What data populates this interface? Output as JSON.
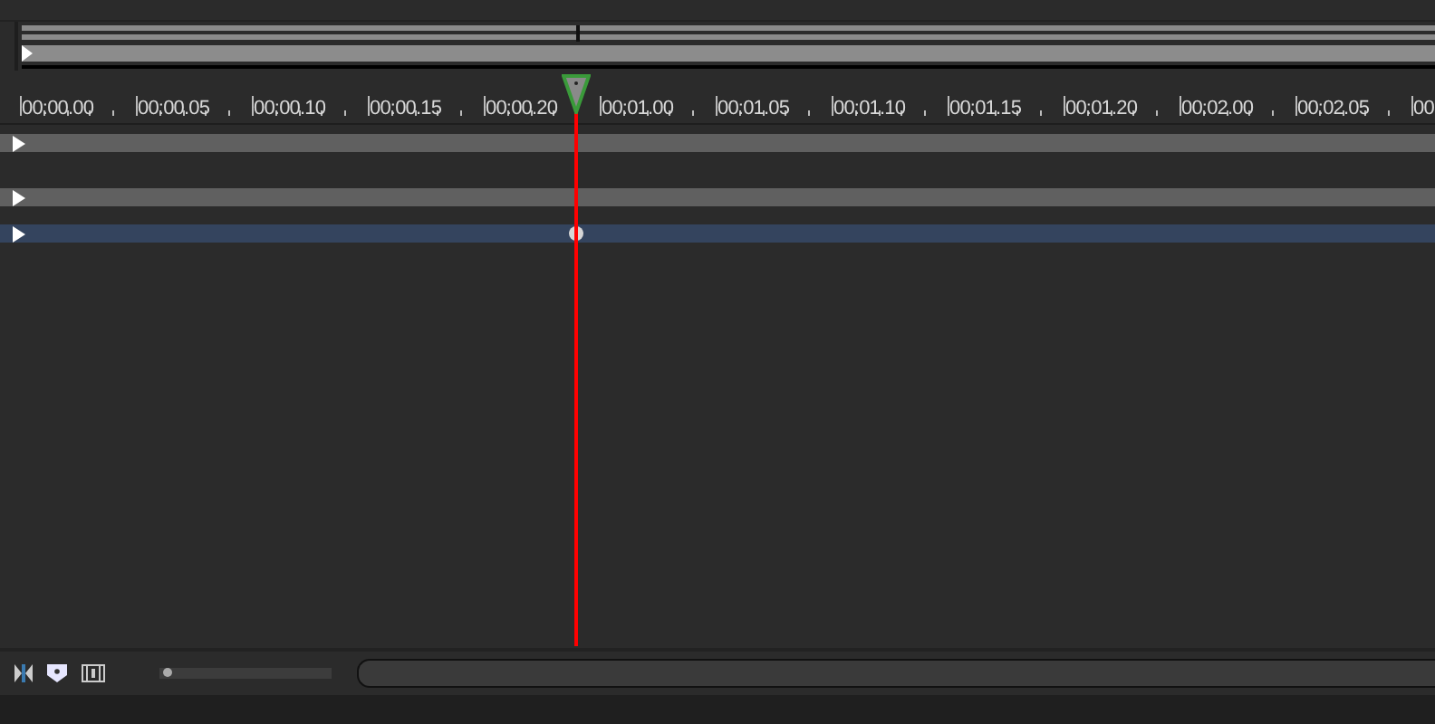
{
  "ruler": {
    "labels": [
      "00:00.00",
      "00:00.05",
      "00:00.10",
      "00:00.15",
      "00:00.20",
      "00:01.00",
      "00:01.05",
      "00:01.10",
      "00:01.15",
      "00:01.20",
      "00:02.00",
      "00:02.05",
      "00"
    ]
  },
  "tracks": [
    {
      "selected": false
    },
    {
      "selected": false
    },
    {
      "selected": true
    }
  ],
  "zoom_slider": {
    "level": 0.02
  }
}
